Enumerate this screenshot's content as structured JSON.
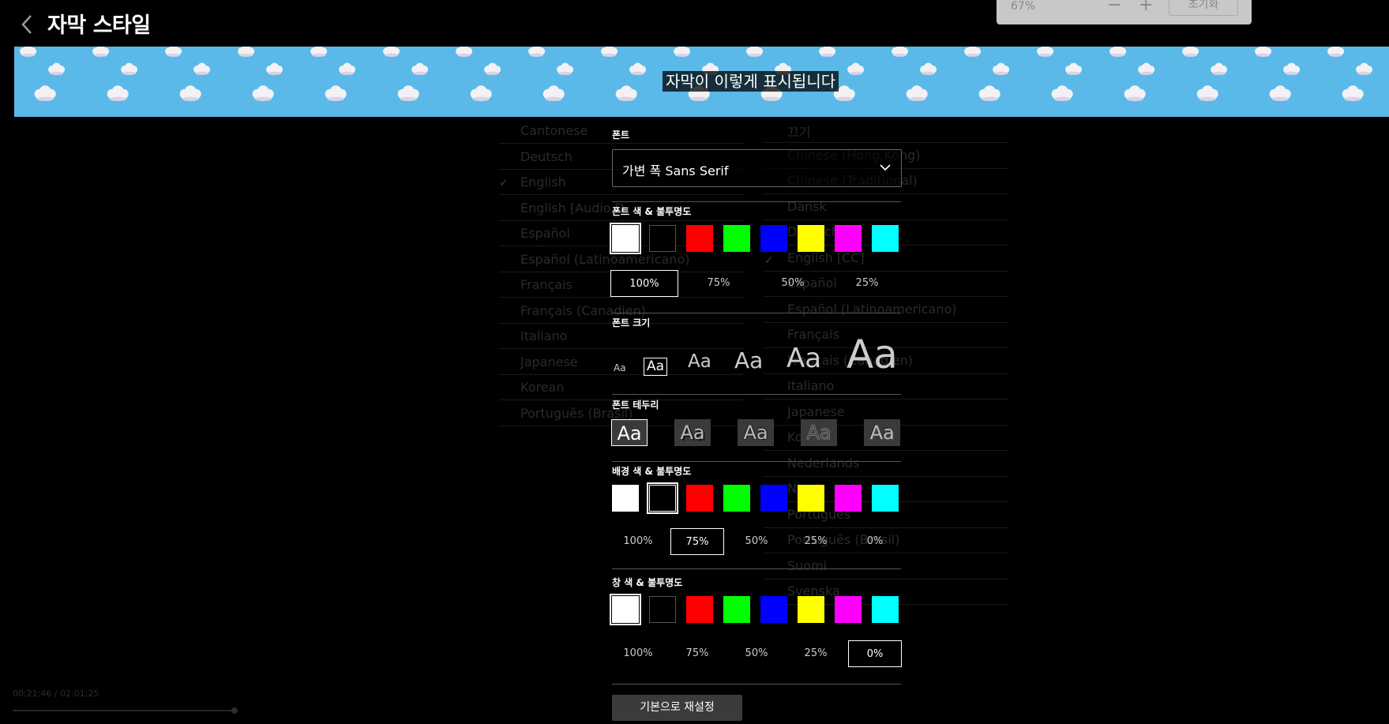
{
  "header": {
    "title": "자막 스타일",
    "back_icon": "chevron-left-icon"
  },
  "zoom": {
    "value": "67%",
    "minus": "−",
    "plus": "+",
    "reset": "초기화"
  },
  "preview": {
    "text": "자막이 이렇게 표시됩니다"
  },
  "background": {
    "audio_languages": [
      "Cantonese",
      "Deutsch",
      "English",
      "English [Audio D",
      "Español",
      "Español (Latinoamericano)",
      "Français",
      "Français (Canadien)",
      "Italiano",
      "Japanese",
      "Korean",
      "Português (Brasil)"
    ],
    "subtitle_languages": [
      "끄기",
      "Chinese (Hong Kong)",
      "Chinese (Traditional)",
      "Dansk",
      "Deutsch",
      "English [CC]",
      "Español",
      "Español (Latinoamericano)",
      "Français",
      "Français (Canadien)",
      "Italiano",
      "Japanese",
      "Korean",
      "Nederlands",
      "Norsk",
      "Português",
      "Português (Brasil)",
      "Suomi",
      "Svenska"
    ],
    "time": "00:21:46 / 02:01:25"
  },
  "font": {
    "label": "폰트",
    "value": "가변 폭 Sans Serif"
  },
  "font_color": {
    "label": "폰트 색 & 불투명도",
    "colors": [
      "#ffffff",
      "#000000",
      "#ff0000",
      "#00ff00",
      "#0000ff",
      "#ffff00",
      "#ff00ff",
      "#00ffff"
    ],
    "selected": 0,
    "opacities": [
      "100%",
      "75%",
      "50%",
      "25%"
    ],
    "selected_opacity": 0
  },
  "font_size": {
    "label": "폰트 크기",
    "options": [
      "Aa",
      "Aa",
      "Aa",
      "Aa",
      "Aa",
      "Aa"
    ],
    "selected": 1
  },
  "font_edge": {
    "label": "폰트 테두리",
    "options": [
      "Aa",
      "Aa",
      "Aa",
      "Aa",
      "Aa"
    ],
    "selected": 0
  },
  "bg_color": {
    "label": "배경 색 & 불투명도",
    "colors": [
      "#ffffff",
      "#000000",
      "#ff0000",
      "#00ff00",
      "#0000ff",
      "#ffff00",
      "#ff00ff",
      "#00ffff"
    ],
    "selected": 1,
    "opacities": [
      "100%",
      "75%",
      "50%",
      "25%",
      "0%"
    ],
    "selected_opacity": 1
  },
  "window_color": {
    "label": "창 색 & 불투명도",
    "colors": [
      "#ffffff",
      "#000000",
      "#ff0000",
      "#00ff00",
      "#0000ff",
      "#ffff00",
      "#ff00ff",
      "#00ffff"
    ],
    "selected": 0,
    "opacities": [
      "100%",
      "75%",
      "50%",
      "25%",
      "0%"
    ],
    "selected_opacity": 4
  },
  "reset": {
    "label": "기본으로 재설정"
  }
}
